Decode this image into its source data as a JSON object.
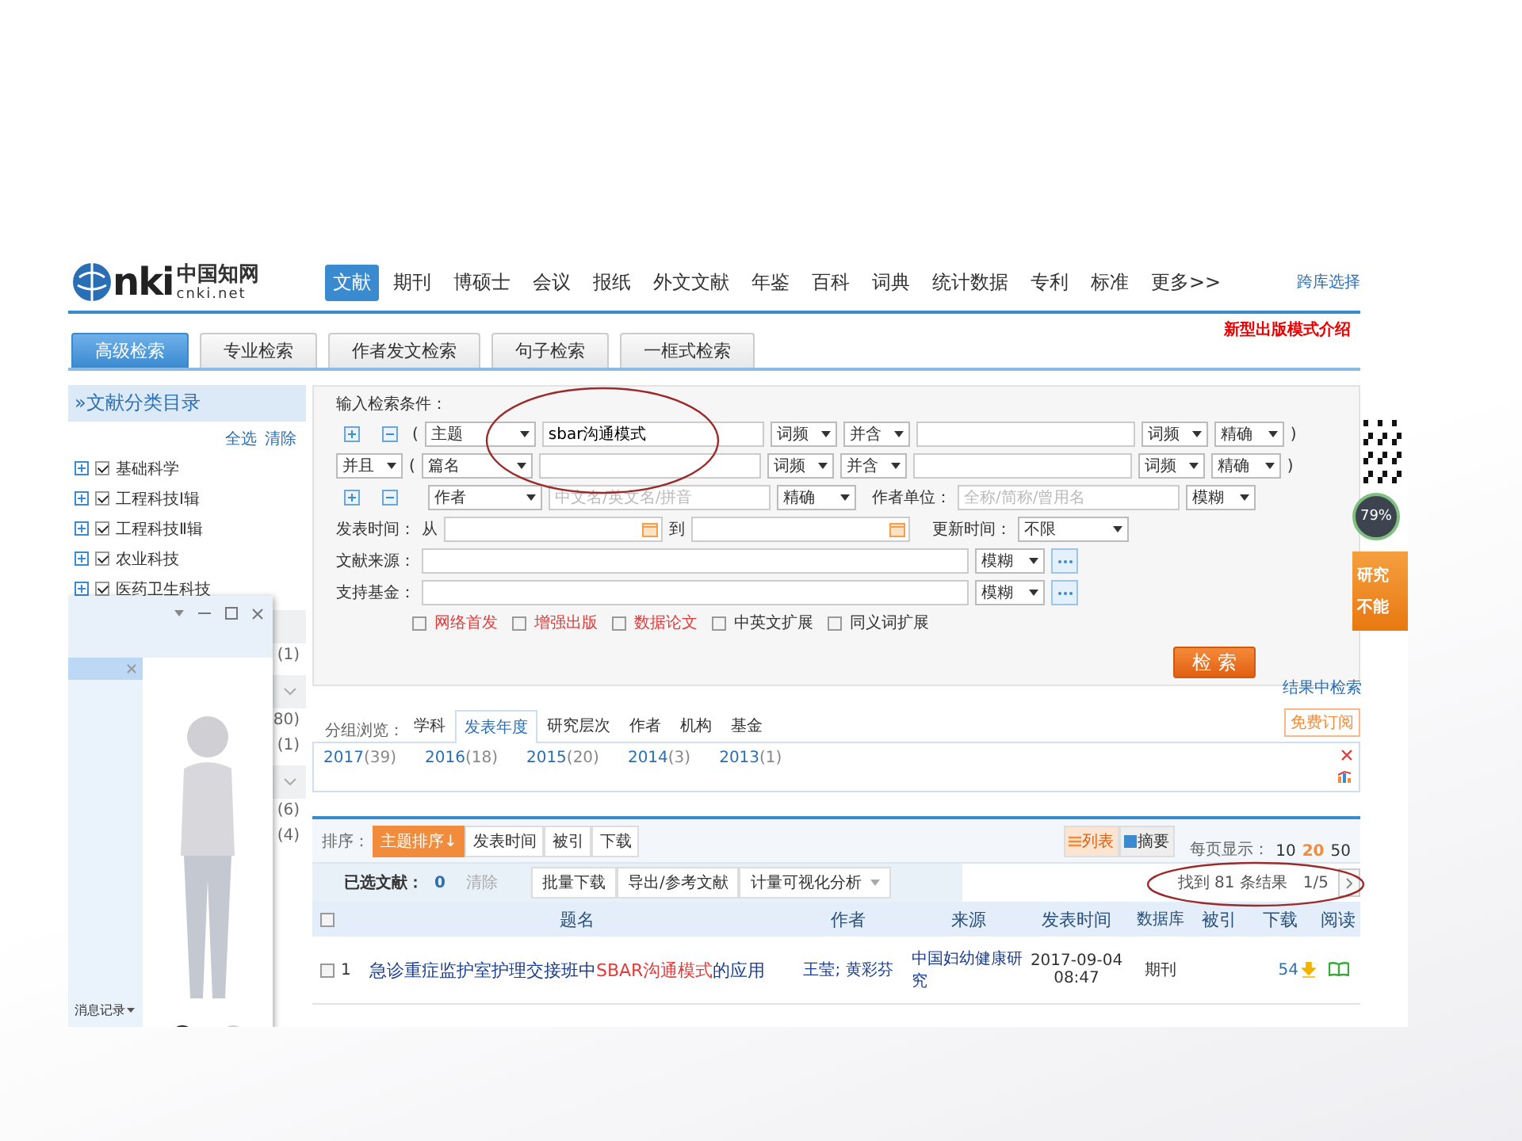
{
  "header": {
    "logo": {
      "letters": "nki",
      "name_cn": "中国知网",
      "domain": "cnki.net"
    },
    "nav": [
      {
        "label": "文献",
        "selected": true
      },
      {
        "label": "期刊",
        "selected": false
      },
      {
        "label": "博硕士",
        "selected": false
      },
      {
        "label": "会议",
        "selected": false
      },
      {
        "label": "报纸",
        "selected": false
      },
      {
        "label": "外文文献",
        "selected": false
      },
      {
        "label": "年鉴",
        "selected": false
      },
      {
        "label": "百科",
        "selected": false
      },
      {
        "label": "词典",
        "selected": false
      },
      {
        "label": "统计数据",
        "selected": false
      },
      {
        "label": "专利",
        "selected": false
      },
      {
        "label": "标准",
        "selected": false
      },
      {
        "label": "更多>>",
        "selected": false
      }
    ],
    "cross_db": "跨库选择",
    "promo": "新型出版模式介绍"
  },
  "subtabs": [
    {
      "label": "高级检索",
      "selected": true
    },
    {
      "label": "专业检索",
      "selected": false
    },
    {
      "label": "作者发文检索",
      "selected": false
    },
    {
      "label": "句子检索",
      "selected": false
    },
    {
      "label": "一框式检索",
      "selected": false
    }
  ],
  "sidebar": {
    "title": "»文献分类目录",
    "select_all": "全选",
    "clear": "清除",
    "categories": [
      {
        "label": "基础科学",
        "checked": true
      },
      {
        "label": "工程科技Ⅰ辑",
        "checked": true
      },
      {
        "label": "工程科技Ⅱ辑",
        "checked": true
      },
      {
        "label": "农业科技",
        "checked": true
      },
      {
        "label": "医药卫生科技",
        "checked": true
      }
    ],
    "groups": [
      {
        "counts": [
          "(1)"
        ]
      },
      {
        "counts": [
          "80)",
          "(1)"
        ]
      },
      {
        "counts": [
          "(6)",
          "(4)"
        ]
      }
    ]
  },
  "chat_window": {
    "footer": "消息记录"
  },
  "search_form": {
    "title": "输入检索条件：",
    "term_rows": [
      {
        "kind": "add_remove",
        "paren_open": "(",
        "field": "主题",
        "value": "sbar沟通模式",
        "freq1": "词频",
        "relation": "并含",
        "freq2": "词频",
        "match": "精确",
        "paren_close": ")"
      },
      {
        "kind": "logic",
        "logic": "并且",
        "paren_open": "(",
        "field": "篇名",
        "freq1": "词频",
        "relation": "并含",
        "freq2": "词频",
        "match": "精确",
        "paren_close": ")"
      }
    ],
    "author_row": {
      "field": "作者",
      "placeholder": "中文名/英文名/拼音",
      "match": "精确",
      "org_label": "作者单位：",
      "org_placeholder": "全称/简称/曾用名",
      "org_match": "模糊"
    },
    "date_row": {
      "label": "发表时间：",
      "from": "从",
      "to": "到",
      "update_label": "更新时间：",
      "update_value": "不限"
    },
    "source_rows": [
      {
        "label": "文献来源：",
        "match": "模糊"
      },
      {
        "label": "支持基金：",
        "match": "模糊"
      }
    ],
    "options": [
      {
        "label": "网络首发",
        "checked": false,
        "color": "#e03c3c"
      },
      {
        "label": "增强出版",
        "checked": false,
        "color": "#e03c3c"
      },
      {
        "label": "数据论文",
        "checked": false,
        "color": "#e03c3c"
      },
      {
        "label": "中英文扩展",
        "checked": false,
        "color": "#333333"
      },
      {
        "label": "同义词扩展",
        "checked": false,
        "color": "#333333"
      }
    ],
    "search_button": "检 索",
    "within_results": "结果中检索"
  },
  "group_browse": {
    "label": "分组浏览：",
    "tabs": [
      {
        "label": "学科",
        "selected": false
      },
      {
        "label": "发表年度",
        "selected": true
      },
      {
        "label": "研究层次",
        "selected": false
      },
      {
        "label": "作者",
        "selected": false
      },
      {
        "label": "机构",
        "selected": false
      },
      {
        "label": "基金",
        "selected": false
      }
    ],
    "subscribe": "免费订阅",
    "years": [
      {
        "year": "2017",
        "count": "(39)"
      },
      {
        "year": "2016",
        "count": "(18)"
      },
      {
        "year": "2015",
        "count": "(20)"
      },
      {
        "year": "2014",
        "count": "(3)"
      },
      {
        "year": "2013",
        "count": "(1)"
      }
    ]
  },
  "results": {
    "sort_label": "排序：",
    "sort_options": [
      {
        "label": "主题排序↓",
        "selected": true
      },
      {
        "label": "发表时间",
        "selected": false
      },
      {
        "label": "被引",
        "selected": false
      },
      {
        "label": "下载",
        "selected": false
      }
    ],
    "view_modes": [
      {
        "label": "列表",
        "selected": true
      },
      {
        "label": "摘要",
        "selected": false
      }
    ],
    "per_page_label": "每页显示：",
    "per_page": [
      {
        "label": "10",
        "selected": false
      },
      {
        "label": "20",
        "selected": true
      },
      {
        "label": "50",
        "selected": false
      }
    ],
    "selected_label": "已选文献：",
    "selected_count": "0",
    "clear": "清除",
    "actions": [
      "批量下载",
      "导出/参考文献",
      "计量可视化分析"
    ],
    "found": "找到 81 条结果",
    "page": "1/5",
    "select_all_checked": false,
    "columns": [
      "题名",
      "作者",
      "来源",
      "发表时间",
      "数据库",
      "被引",
      "下载",
      "阅读"
    ],
    "rows": [
      {
        "checked": false,
        "index": "1",
        "title_parts": [
          {
            "text": "急诊重症监护室护理交接班中",
            "highlight": false
          },
          {
            "text": "SBAR沟通模式",
            "highlight": true
          },
          {
            "text": "的应用",
            "highlight": false
          }
        ],
        "authors": "王莹; 黄彩芬",
        "source": "中国妇幼健康研究",
        "date": "2017-09-04",
        "time": "08:47",
        "database": "期刊",
        "downloads": "54"
      }
    ]
  },
  "widgets": {
    "speed": "79%",
    "ad_lines": [
      "研究",
      "不能"
    ]
  }
}
